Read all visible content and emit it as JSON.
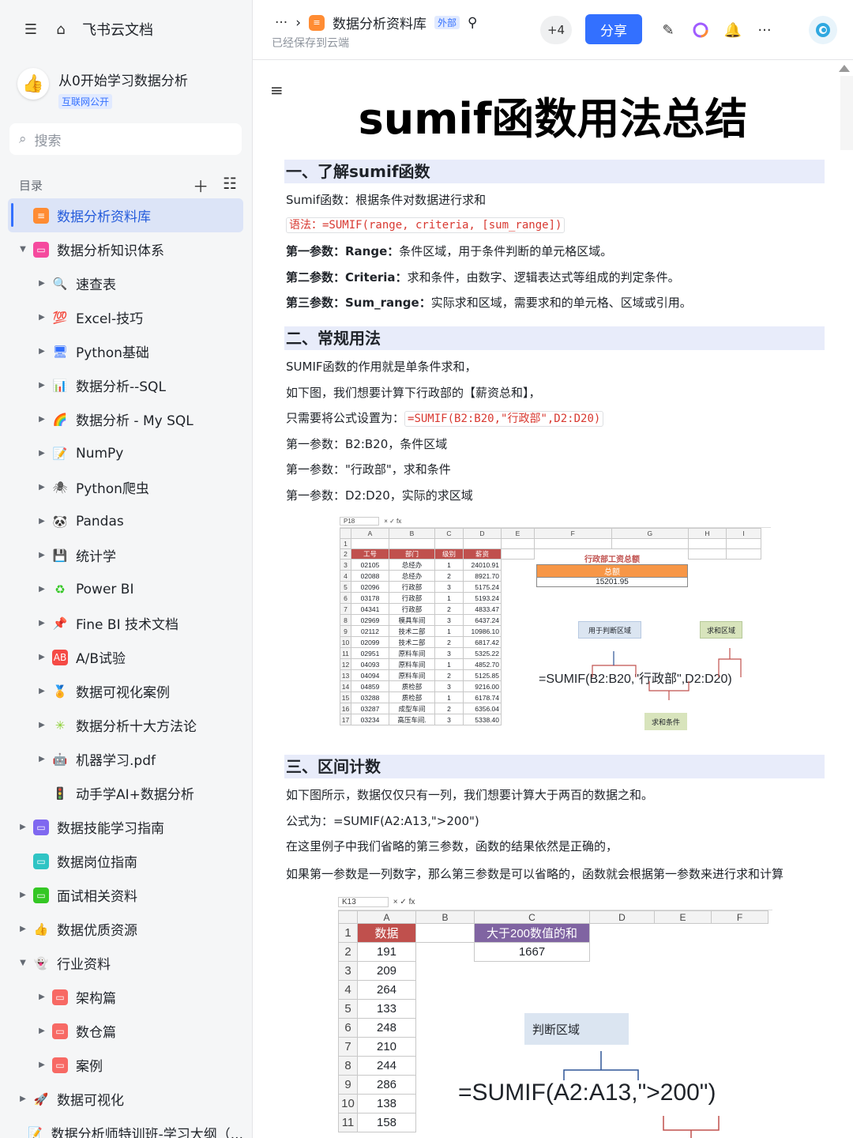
{
  "sidebar": {
    "home_label": "飞书云文档",
    "wiki_title": "从0开始学习数据分析",
    "wiki_badge": "互联网公开",
    "search_placeholder": "搜索",
    "toc_label": "目录",
    "items": [
      {
        "label": "数据分析资料库",
        "level": 0,
        "arrow": "",
        "icon": "doc-icon",
        "color": "#ff8c33",
        "glyph": "≡",
        "active": true
      },
      {
        "label": "数据分析知识体系",
        "level": 0,
        "arrow": "▼",
        "icon": "doc-pink-icon",
        "color": "#f54a9e",
        "glyph": "▭"
      },
      {
        "label": "速查表",
        "level": 1,
        "arrow": "▶",
        "icon": "magnifier-icon",
        "color": "#3370ff",
        "glyph": "🔍"
      },
      {
        "label": "Excel-技巧",
        "level": 1,
        "arrow": "▶",
        "icon": "hundred-icon",
        "color": "#f54a45",
        "glyph": "💯"
      },
      {
        "label": "Python基础",
        "level": 1,
        "arrow": "▶",
        "icon": "monitor-icon",
        "color": "#3370ff",
        "glyph": "🖥"
      },
      {
        "label": "数据分析--SQL",
        "level": 1,
        "arrow": "▶",
        "icon": "bar-chart-icon",
        "color": "#3370ff",
        "glyph": "📊"
      },
      {
        "label": "数据分析 - My SQL",
        "level": 1,
        "arrow": "▶",
        "icon": "rainbow-icon",
        "color": "#ff8c33",
        "glyph": "🌈"
      },
      {
        "label": "NumPy",
        "level": 1,
        "arrow": "▶",
        "icon": "memo-icon",
        "color": "#ff8c33",
        "glyph": "📝"
      },
      {
        "label": "Python爬虫",
        "level": 1,
        "arrow": "▶",
        "icon": "spider-icon",
        "color": "#555",
        "glyph": "🕷"
      },
      {
        "label": "Pandas",
        "level": 1,
        "arrow": "▶",
        "icon": "panda-icon",
        "color": "#333",
        "glyph": "🐼"
      },
      {
        "label": "统计学",
        "level": 1,
        "arrow": "▶",
        "icon": "floppy-icon",
        "color": "#333",
        "glyph": "💾"
      },
      {
        "label": "Power BI",
        "level": 1,
        "arrow": "▶",
        "icon": "recycle-icon",
        "color": "#34c724",
        "glyph": "♻"
      },
      {
        "label": "Fine BI 技术文档",
        "level": 1,
        "arrow": "▶",
        "icon": "pin-icon",
        "color": "#f54a45",
        "glyph": "📌"
      },
      {
        "label": "A/B试验",
        "level": 1,
        "arrow": "▶",
        "icon": "ab-icon",
        "color": "#f54a45",
        "glyph": "AB"
      },
      {
        "label": "数据可视化案例",
        "level": 1,
        "arrow": "▶",
        "icon": "medal-icon",
        "color": "#ffc60a",
        "glyph": "🏅"
      },
      {
        "label": "数据分析十大方法论",
        "level": 1,
        "arrow": "▶",
        "icon": "sparkle-icon",
        "color": "#8ad030",
        "glyph": "✳"
      },
      {
        "label": "机器学习.pdf",
        "level": 1,
        "arrow": "▶",
        "icon": "robot-icon",
        "color": "#555",
        "glyph": "🤖"
      },
      {
        "label": "动手学AI+数据分析",
        "level": 1,
        "arrow": "",
        "icon": "traffic-light-icon",
        "color": "#333",
        "glyph": "🚦"
      },
      {
        "label": "数据技能学习指南",
        "level": 0,
        "arrow": "▶",
        "icon": "doc-purple-icon",
        "color": "#7f68f0",
        "glyph": "▭"
      },
      {
        "label": "数据岗位指南",
        "level": 0,
        "arrow": "",
        "icon": "doc-teal-icon",
        "color": "#2fc4c4",
        "glyph": "▭"
      },
      {
        "label": "面试相关资料",
        "level": 0,
        "arrow": "▶",
        "icon": "doc-green-icon",
        "color": "#34c724",
        "glyph": "▭"
      },
      {
        "label": "数据优质资源",
        "level": 0,
        "arrow": "▶",
        "icon": "thumbs-up-icon",
        "color": "#ffc60a",
        "glyph": "👍"
      },
      {
        "label": "行业资料",
        "level": 0,
        "arrow": "▼",
        "icon": "ghost-icon",
        "color": "#999",
        "glyph": "👻"
      },
      {
        "label": "架构篇",
        "level": 1,
        "arrow": "▶",
        "icon": "doc-red-icon",
        "color": "#f76964",
        "glyph": "▭"
      },
      {
        "label": "数仓篇",
        "level": 1,
        "arrow": "▶",
        "icon": "doc-orange-icon",
        "color": "#f76964",
        "glyph": "▭"
      },
      {
        "label": "案例",
        "level": 1,
        "arrow": "▶",
        "icon": "doc-salmon-icon",
        "color": "#f76964",
        "glyph": "▭"
      },
      {
        "label": "数据可视化",
        "level": 0,
        "arrow": "▶",
        "icon": "rocket-icon",
        "color": "#f54a45",
        "glyph": "🚀"
      },
      {
        "label": "数据分析师特训班-学习大纲（...",
        "level": 0,
        "arrow": "",
        "icon": "memo-icon",
        "color": "#ff8c33",
        "glyph": "📝"
      }
    ]
  },
  "header": {
    "breadcrumb_title": "数据分析资料库",
    "external_badge": "外部",
    "saved_status": "已经保存到云端",
    "collaborators": "+4",
    "share_label": "分享"
  },
  "doc": {
    "title": "sumif函数用法总结",
    "s1": {
      "heading": "一、了解sumif函数",
      "intro": "Sumif函数：根据条件对数据进行求和",
      "syntax": "语法：=SUMIF(range, criteria, [sum_range])",
      "p1_bold": "第一参数：Range：",
      "p1": "条件区域，用于条件判断的单元格区域。",
      "p2_bold": "第二参数：Criteria：",
      "p2": "求和条件，由数字、逻辑表达式等组成的判定条件。",
      "p3_bold": "第三参数：Sum_range：",
      "p3": "实际求和区域，需要求和的单元格、区域或引用。"
    },
    "s2": {
      "heading": "二、常规用法",
      "l1": "SUMIF函数的作用就是单条件求和，",
      "l2": "如下图，我们想要计算下行政部的【薪资总和】，",
      "l3": "只需要将公式设置为：",
      "l3_code": "=SUMIF(B2:B20,\"行政部\",D2:D20)",
      "l4": "第一参数：B2:B20，条件区域",
      "l5": "第一参数：\"行政部\"，求和条件",
      "l6": "第一参数：D2:D20，实际的求区域"
    },
    "s3": {
      "heading": "三、区间计数",
      "l1": "如下图所示，数据仅仅只有一列，我们想要计算大于两百的数据之和。",
      "l2": "公式为：=SUMIF(A2:A13,\">200\")",
      "l3": "在这里例子中我们省略的第三参数，函数的结果依然是正确的，",
      "l4": "如果第一参数是一列数字，那么第三参数是可以省略的，函数就会根据第一参数来进行求和计算"
    }
  },
  "sheet1": {
    "cell_ref": "P18",
    "cols": [
      "A",
      "B",
      "C",
      "D",
      "E",
      "F",
      "G",
      "H",
      "I"
    ],
    "headers": [
      "工号",
      "部门",
      "级别",
      "薪资"
    ],
    "rows": [
      [
        "02105",
        "总经办",
        "1",
        "24010.91"
      ],
      [
        "02088",
        "总经办",
        "2",
        "8921.70"
      ],
      [
        "02096",
        "行政部",
        "3",
        "5175.24"
      ],
      [
        "03178",
        "行政部",
        "1",
        "5193.24"
      ],
      [
        "04341",
        "行政部",
        "2",
        "4833.47"
      ],
      [
        "02969",
        "模具车间",
        "3",
        "6437.24"
      ],
      [
        "02112",
        "技术二部",
        "1",
        "10986.10"
      ],
      [
        "02099",
        "技术二部",
        "2",
        "6817.42"
      ],
      [
        "02951",
        "原料车间",
        "3",
        "5325.22"
      ],
      [
        "04093",
        "原料车间",
        "1",
        "4852.70"
      ],
      [
        "04094",
        "原料车间",
        "2",
        "5125.85"
      ],
      [
        "04859",
        "质检部",
        "3",
        "9216.00"
      ],
      [
        "03288",
        "质检部",
        "1",
        "6178.74"
      ],
      [
        "03287",
        "成型车间",
        "2",
        "6356.04"
      ],
      [
        "03234",
        "高压车间.",
        "3",
        "5338.40"
      ]
    ],
    "box_title": "行政部工资总额",
    "box_header": "总额",
    "box_value": "15201.95",
    "label_range": "用于判断区域",
    "label_sum": "求和区域",
    "label_criteria": "求和条件",
    "formula": "=SUMIF(B2:B20,\"行政部\",D2:D20)"
  },
  "sheet2": {
    "cell_ref": "K13",
    "cols": [
      "A",
      "B",
      "C",
      "D",
      "E",
      "F"
    ],
    "header": "数据",
    "values": [
      "191",
      "209",
      "264",
      "133",
      "248",
      "210",
      "244",
      "286",
      "138",
      "158"
    ],
    "result_header": "大于200数值的和",
    "result_value": "1667",
    "label_range": "判断区域",
    "formula": "=SUMIF(A2:A13,\">200\")"
  }
}
